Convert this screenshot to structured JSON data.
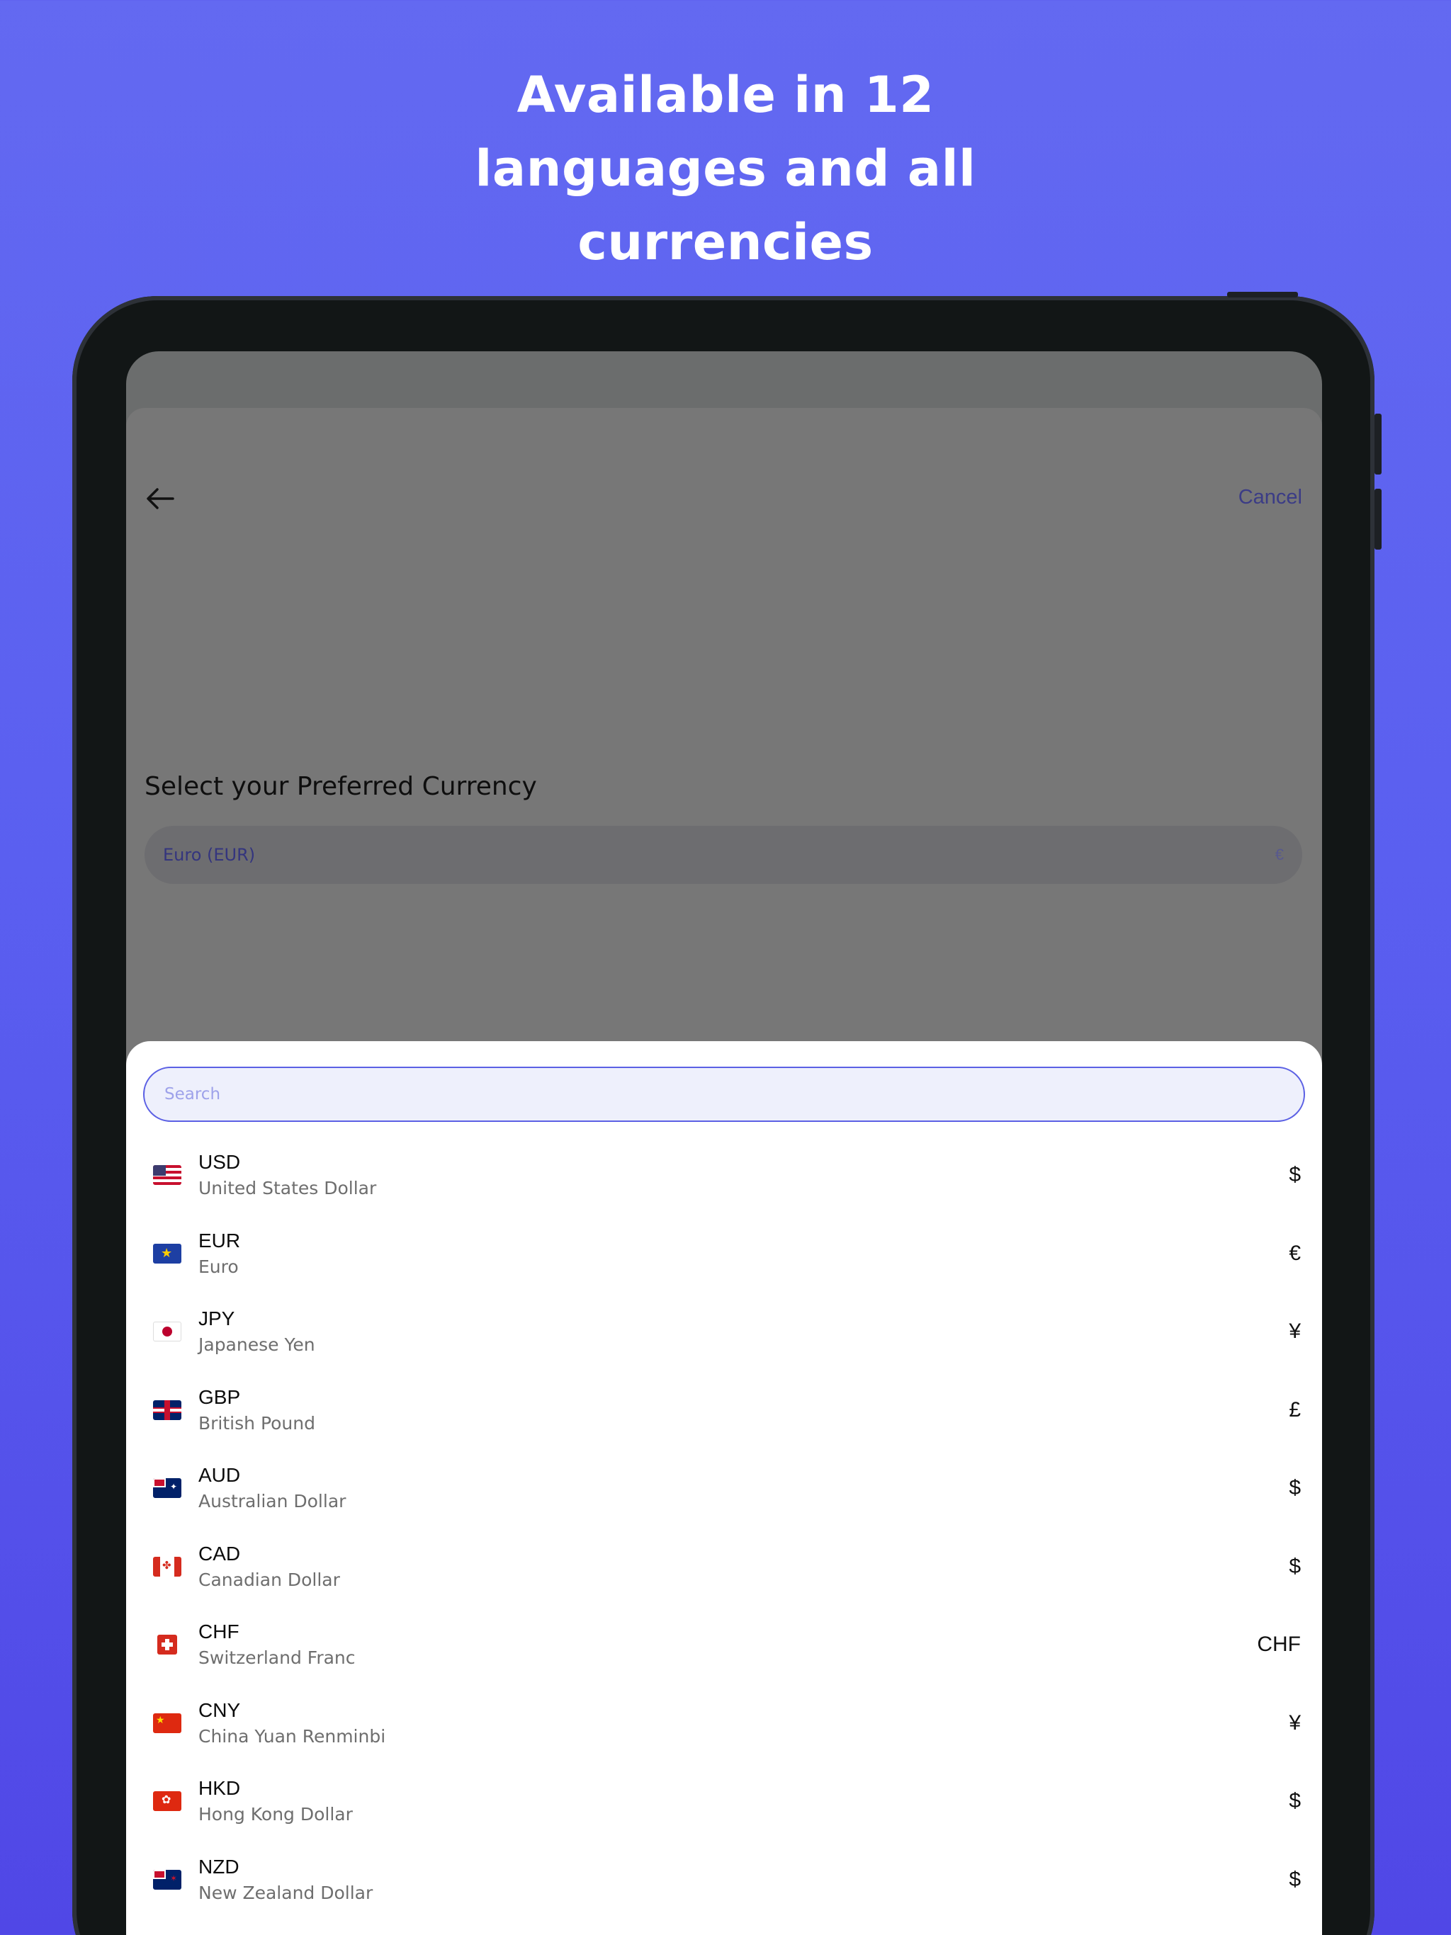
{
  "headline": {
    "line1": "Available in 12",
    "line2": "languages and all",
    "line3": "currencies"
  },
  "header": {
    "cancel_label": "Cancel"
  },
  "currency_screen": {
    "title": "Select your Preferred Currency",
    "selected_label": "Euro (EUR)",
    "selected_symbol": "€"
  },
  "picker": {
    "search_placeholder": "Search",
    "items": [
      {
        "code": "USD",
        "name": "United States Dollar",
        "symbol": "$",
        "flag": "us-flag"
      },
      {
        "code": "EUR",
        "name": "Euro",
        "symbol": "€",
        "flag": "eu-flag"
      },
      {
        "code": "JPY",
        "name": "Japanese Yen",
        "symbol": "¥",
        "flag": "jp-flag"
      },
      {
        "code": "GBP",
        "name": "British Pound",
        "symbol": "£",
        "flag": "gb-flag"
      },
      {
        "code": "AUD",
        "name": "Australian Dollar",
        "symbol": "$",
        "flag": "au-flag"
      },
      {
        "code": "CAD",
        "name": "Canadian Dollar",
        "symbol": "$",
        "flag": "ca-flag"
      },
      {
        "code": "CHF",
        "name": "Switzerland Franc",
        "symbol": "CHF",
        "flag": "ch-flag"
      },
      {
        "code": "CNY",
        "name": "China Yuan Renminbi",
        "symbol": "¥",
        "flag": "cn-flag"
      },
      {
        "code": "HKD",
        "name": "Hong Kong Dollar",
        "symbol": "$",
        "flag": "hk-flag"
      },
      {
        "code": "NZD",
        "name": "New Zealand Dollar",
        "symbol": "$",
        "flag": "nz-flag"
      }
    ]
  },
  "colors": {
    "background_top": "#6369f1",
    "background_bottom": "#5047e6",
    "accent": "#5b60e4",
    "device_frame": "#121616"
  }
}
